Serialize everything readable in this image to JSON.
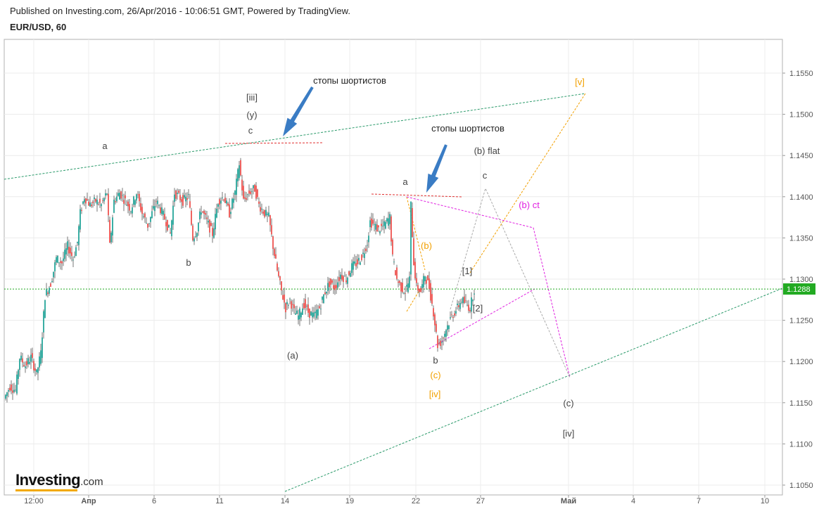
{
  "header": {
    "published": "Published on Investing.com, 26/Apr/2016 - 10:06:51 GMT, Powered by TradingView.",
    "symbol": "EUR/USD, 60"
  },
  "logo": {
    "brand": "Investing",
    "domain": ".com"
  },
  "colors": {
    "bull": "#26a69a",
    "bear": "#ef5350",
    "wick": "#555555",
    "price_line": "#22aa22",
    "price_badge": "#22aa22",
    "channel": "#2a9a6a",
    "orange": "#f2a000",
    "magenta": "#e020e0",
    "gray": "#aaaaaa",
    "red_dash": "#e03030",
    "arrow": "#3a7cc4"
  },
  "chart_data": {
    "type": "candlestick",
    "title": "EUR/USD, 60",
    "ylim": [
      1.1035,
      1.1595
    ],
    "yticks": [
      "1.1050",
      "1.1100",
      "1.1150",
      "1.1200",
      "1.1250",
      "1.1300",
      "1.1350",
      "1.1400",
      "1.1450",
      "1.1500",
      "1.1550"
    ],
    "xticks": [
      {
        "label": "12:00",
        "bold": false
      },
      {
        "label": "Апр",
        "bold": true
      },
      {
        "label": "6",
        "bold": false
      },
      {
        "label": "11",
        "bold": false
      },
      {
        "label": "14",
        "bold": false
      },
      {
        "label": "19",
        "bold": false
      },
      {
        "label": "22",
        "bold": false
      },
      {
        "label": "27",
        "bold": false
      },
      {
        "label": "Май",
        "bold": true
      },
      {
        "label": "4",
        "bold": false
      },
      {
        "label": "7",
        "bold": false
      },
      {
        "label": "10",
        "bold": false
      }
    ],
    "last_price": "1.1288",
    "price_path": [
      [
        0,
        1.1155
      ],
      [
        8,
        1.117
      ],
      [
        16,
        1.1165
      ],
      [
        22,
        1.1205
      ],
      [
        30,
        1.1195
      ],
      [
        38,
        1.1205
      ],
      [
        46,
        1.1185
      ],
      [
        52,
        1.121
      ],
      [
        58,
        1.128
      ],
      [
        66,
        1.1295
      ],
      [
        74,
        1.1325
      ],
      [
        82,
        1.132
      ],
      [
        90,
        1.134
      ],
      [
        98,
        1.1325
      ],
      [
        104,
        1.1345
      ],
      [
        108,
        1.138
      ],
      [
        114,
        1.14
      ],
      [
        122,
        1.139
      ],
      [
        130,
        1.1395
      ],
      [
        138,
        1.139
      ],
      [
        146,
        1.1405
      ],
      [
        150,
        1.134
      ],
      [
        156,
        1.1395
      ],
      [
        164,
        1.1405
      ],
      [
        172,
        1.1395
      ],
      [
        180,
        1.1385
      ],
      [
        188,
        1.1405
      ],
      [
        196,
        1.138
      ],
      [
        204,
        1.1365
      ],
      [
        210,
        1.138
      ],
      [
        216,
        1.1395
      ],
      [
        222,
        1.1385
      ],
      [
        230,
        1.137
      ],
      [
        236,
        1.1355
      ],
      [
        242,
        1.1405
      ],
      [
        248,
        1.14
      ],
      [
        254,
        1.1395
      ],
      [
        262,
        1.14
      ],
      [
        268,
        1.135
      ],
      [
        274,
        1.136
      ],
      [
        280,
        1.1385
      ],
      [
        288,
        1.137
      ],
      [
        296,
        1.1355
      ],
      [
        304,
        1.1395
      ],
      [
        312,
        1.14
      ],
      [
        320,
        1.138
      ],
      [
        328,
        1.1405
      ],
      [
        334,
        1.144
      ],
      [
        340,
        1.1395
      ],
      [
        348,
        1.1405
      ],
      [
        356,
        1.141
      ],
      [
        362,
        1.139
      ],
      [
        370,
        1.138
      ],
      [
        376,
        1.1375
      ],
      [
        382,
        1.134
      ],
      [
        388,
        1.131
      ],
      [
        394,
        1.1285
      ],
      [
        400,
        1.1265
      ],
      [
        406,
        1.1275
      ],
      [
        412,
        1.126
      ],
      [
        418,
        1.1255
      ],
      [
        426,
        1.127
      ],
      [
        432,
        1.126
      ],
      [
        440,
        1.1255
      ],
      [
        448,
        1.1265
      ],
      [
        456,
        1.1285
      ],
      [
        462,
        1.1295
      ],
      [
        470,
        1.129
      ],
      [
        478,
        1.1305
      ],
      [
        486,
        1.13
      ],
      [
        494,
        1.1315
      ],
      [
        502,
        1.132
      ],
      [
        510,
        1.133
      ],
      [
        516,
        1.1345
      ],
      [
        520,
        1.137
      ],
      [
        526,
        1.1365
      ],
      [
        532,
        1.136
      ],
      [
        540,
        1.1365
      ],
      [
        548,
        1.1375
      ],
      [
        552,
        1.1325
      ],
      [
        558,
        1.13
      ],
      [
        564,
        1.129
      ],
      [
        570,
        1.1285
      ],
      [
        576,
        1.13
      ],
      [
        578,
        1.139
      ],
      [
        582,
        1.132
      ],
      [
        586,
        1.129
      ],
      [
        592,
        1.1285
      ],
      [
        598,
        1.1305
      ],
      [
        604,
        1.129
      ],
      [
        610,
        1.126
      ],
      [
        616,
        1.122
      ],
      [
        622,
        1.1225
      ],
      [
        628,
        1.124
      ],
      [
        636,
        1.1255
      ],
      [
        644,
        1.1265
      ],
      [
        650,
        1.1275
      ],
      [
        656,
        1.127
      ],
      [
        662,
        1.1265
      ],
      [
        668,
        1.1288
      ]
    ],
    "annotations": [
      {
        "text": "стопы шортистов",
        "color": "#222222"
      },
      {
        "text": "стопы шортистов",
        "color": "#222222"
      },
      {
        "text": "[iii]",
        "color": "#444444"
      },
      {
        "text": "(y)",
        "color": "#444444"
      },
      {
        "text": "c",
        "color": "#444444"
      },
      {
        "text": "a",
        "color": "#444444"
      },
      {
        "text": "b",
        "color": "#444444"
      },
      {
        "text": "(a)",
        "color": "#444444"
      },
      {
        "text": "a",
        "color": "#444444"
      },
      {
        "text": "(b) flat",
        "color": "#444444"
      },
      {
        "text": "c",
        "color": "#444444"
      },
      {
        "text": "(b)",
        "color": "#f2a000"
      },
      {
        "text": "[1]",
        "color": "#444444"
      },
      {
        "text": "[2]",
        "color": "#444444"
      },
      {
        "text": "b",
        "color": "#444444"
      },
      {
        "text": "(c)",
        "color": "#f2a000"
      },
      {
        "text": "[iv]",
        "color": "#f2a000"
      },
      {
        "text": "(b) ct",
        "color": "#e020e0"
      },
      {
        "text": "[v]",
        "color": "#f2a000"
      },
      {
        "text": "(c)",
        "color": "#444444"
      },
      {
        "text": "[iv]",
        "color": "#444444"
      }
    ]
  }
}
